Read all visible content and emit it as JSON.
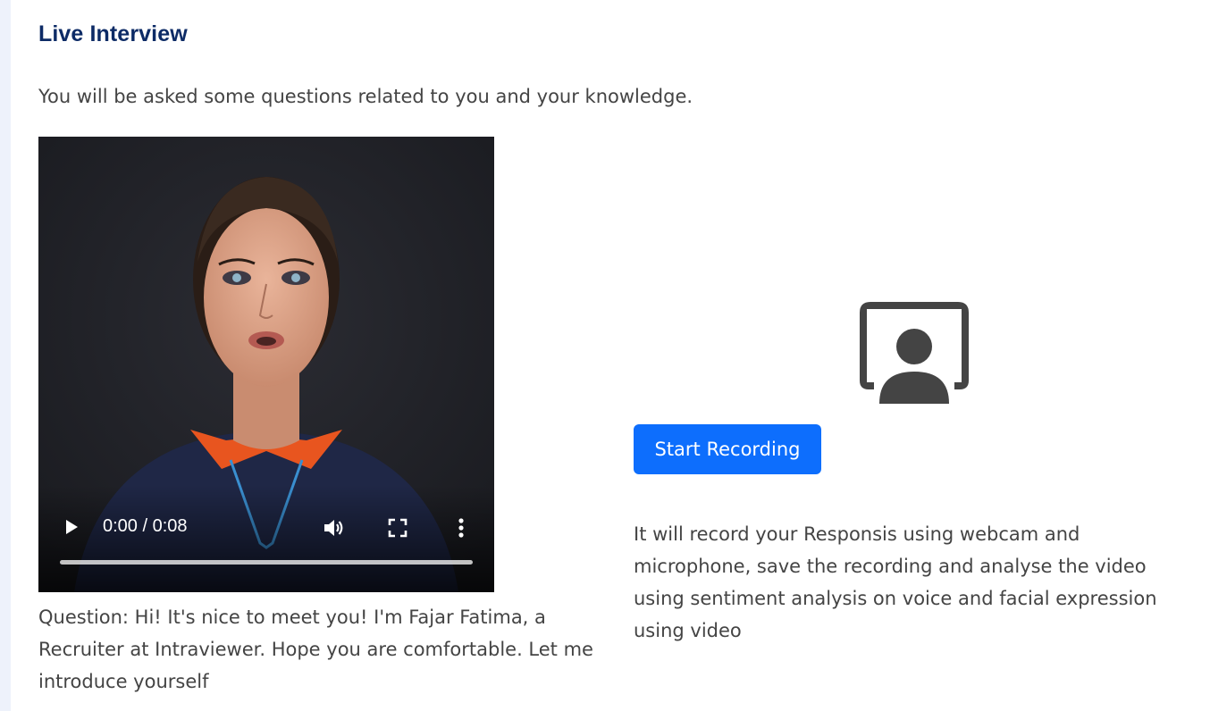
{
  "page": {
    "title": "Live Interview",
    "intro": "You will be asked some questions related to you and your knowledge."
  },
  "video": {
    "time": "0:00 / 0:08",
    "progress_fraction": 0
  },
  "question": {
    "text": "Question: Hi! It's nice to meet you! I'm Fajar Fatima, a Recruiter at Intraviewer. Hope you are comfortable. Let me introduce yourself"
  },
  "recorder": {
    "start_label": "Start Recording",
    "description": "It will record your Responsis using webcam and microphone, save the recording and analyse the video using sentiment analysis on voice and facial expression using video"
  },
  "colors": {
    "title": "#0d2b66",
    "primary_button": "#0d6efd",
    "body_text": "#444444",
    "icon": "#444444"
  },
  "icons": {
    "play": "play-icon",
    "volume": "volume-icon",
    "fullscreen": "fullscreen-icon",
    "menu": "more-vertical-icon",
    "webcam": "webcam-user-icon"
  }
}
